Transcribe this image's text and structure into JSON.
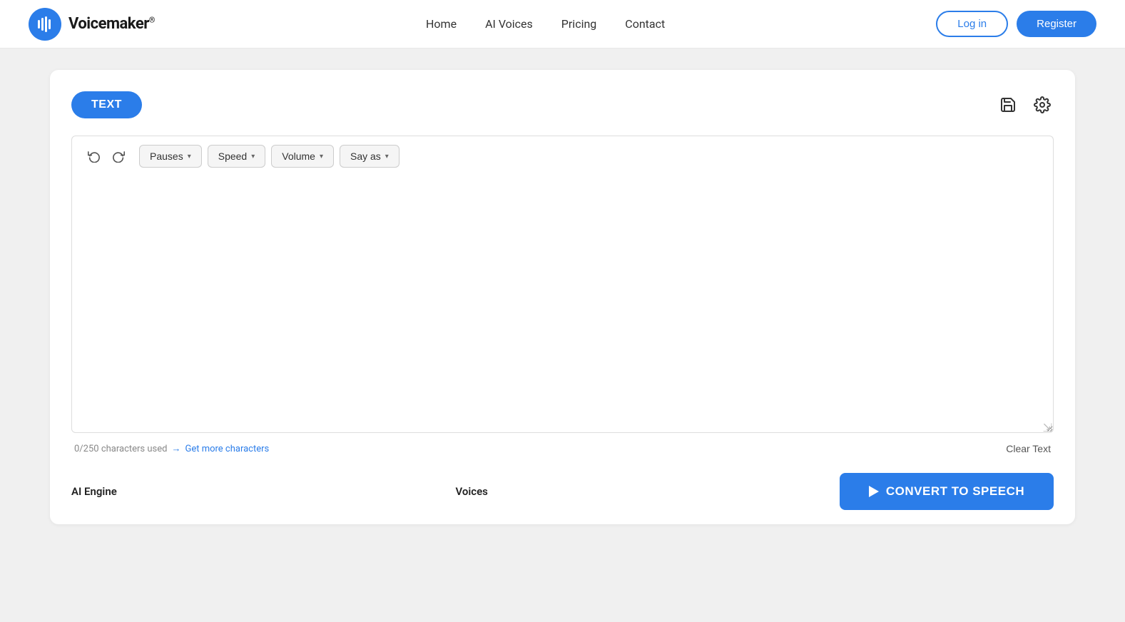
{
  "navbar": {
    "brand": {
      "name": "Voicemaker",
      "trademark": "®"
    },
    "links": [
      {
        "label": "Home",
        "id": "home"
      },
      {
        "label": "AI Voices",
        "id": "ai-voices"
      },
      {
        "label": "Pricing",
        "id": "pricing"
      },
      {
        "label": "Contact",
        "id": "contact"
      }
    ],
    "login_label": "Log in",
    "register_label": "Register"
  },
  "card": {
    "text_tab_label": "TEXT",
    "save_icon": "💾",
    "settings_icon": "⚙"
  },
  "toolbar": {
    "undo_title": "Undo",
    "redo_title": "Redo",
    "pauses_label": "Pauses",
    "speed_label": "Speed",
    "volume_label": "Volume",
    "say_as_label": "Say as"
  },
  "editor": {
    "placeholder": "",
    "value": ""
  },
  "char_count": {
    "used": "0/250 characters used",
    "get_more_label": "Get more characters",
    "clear_label": "Clear Text"
  },
  "bottom": {
    "ai_engine_label": "AI Engine",
    "voices_label": "Voices",
    "convert_label": "CONVERT TO SPEECH"
  }
}
